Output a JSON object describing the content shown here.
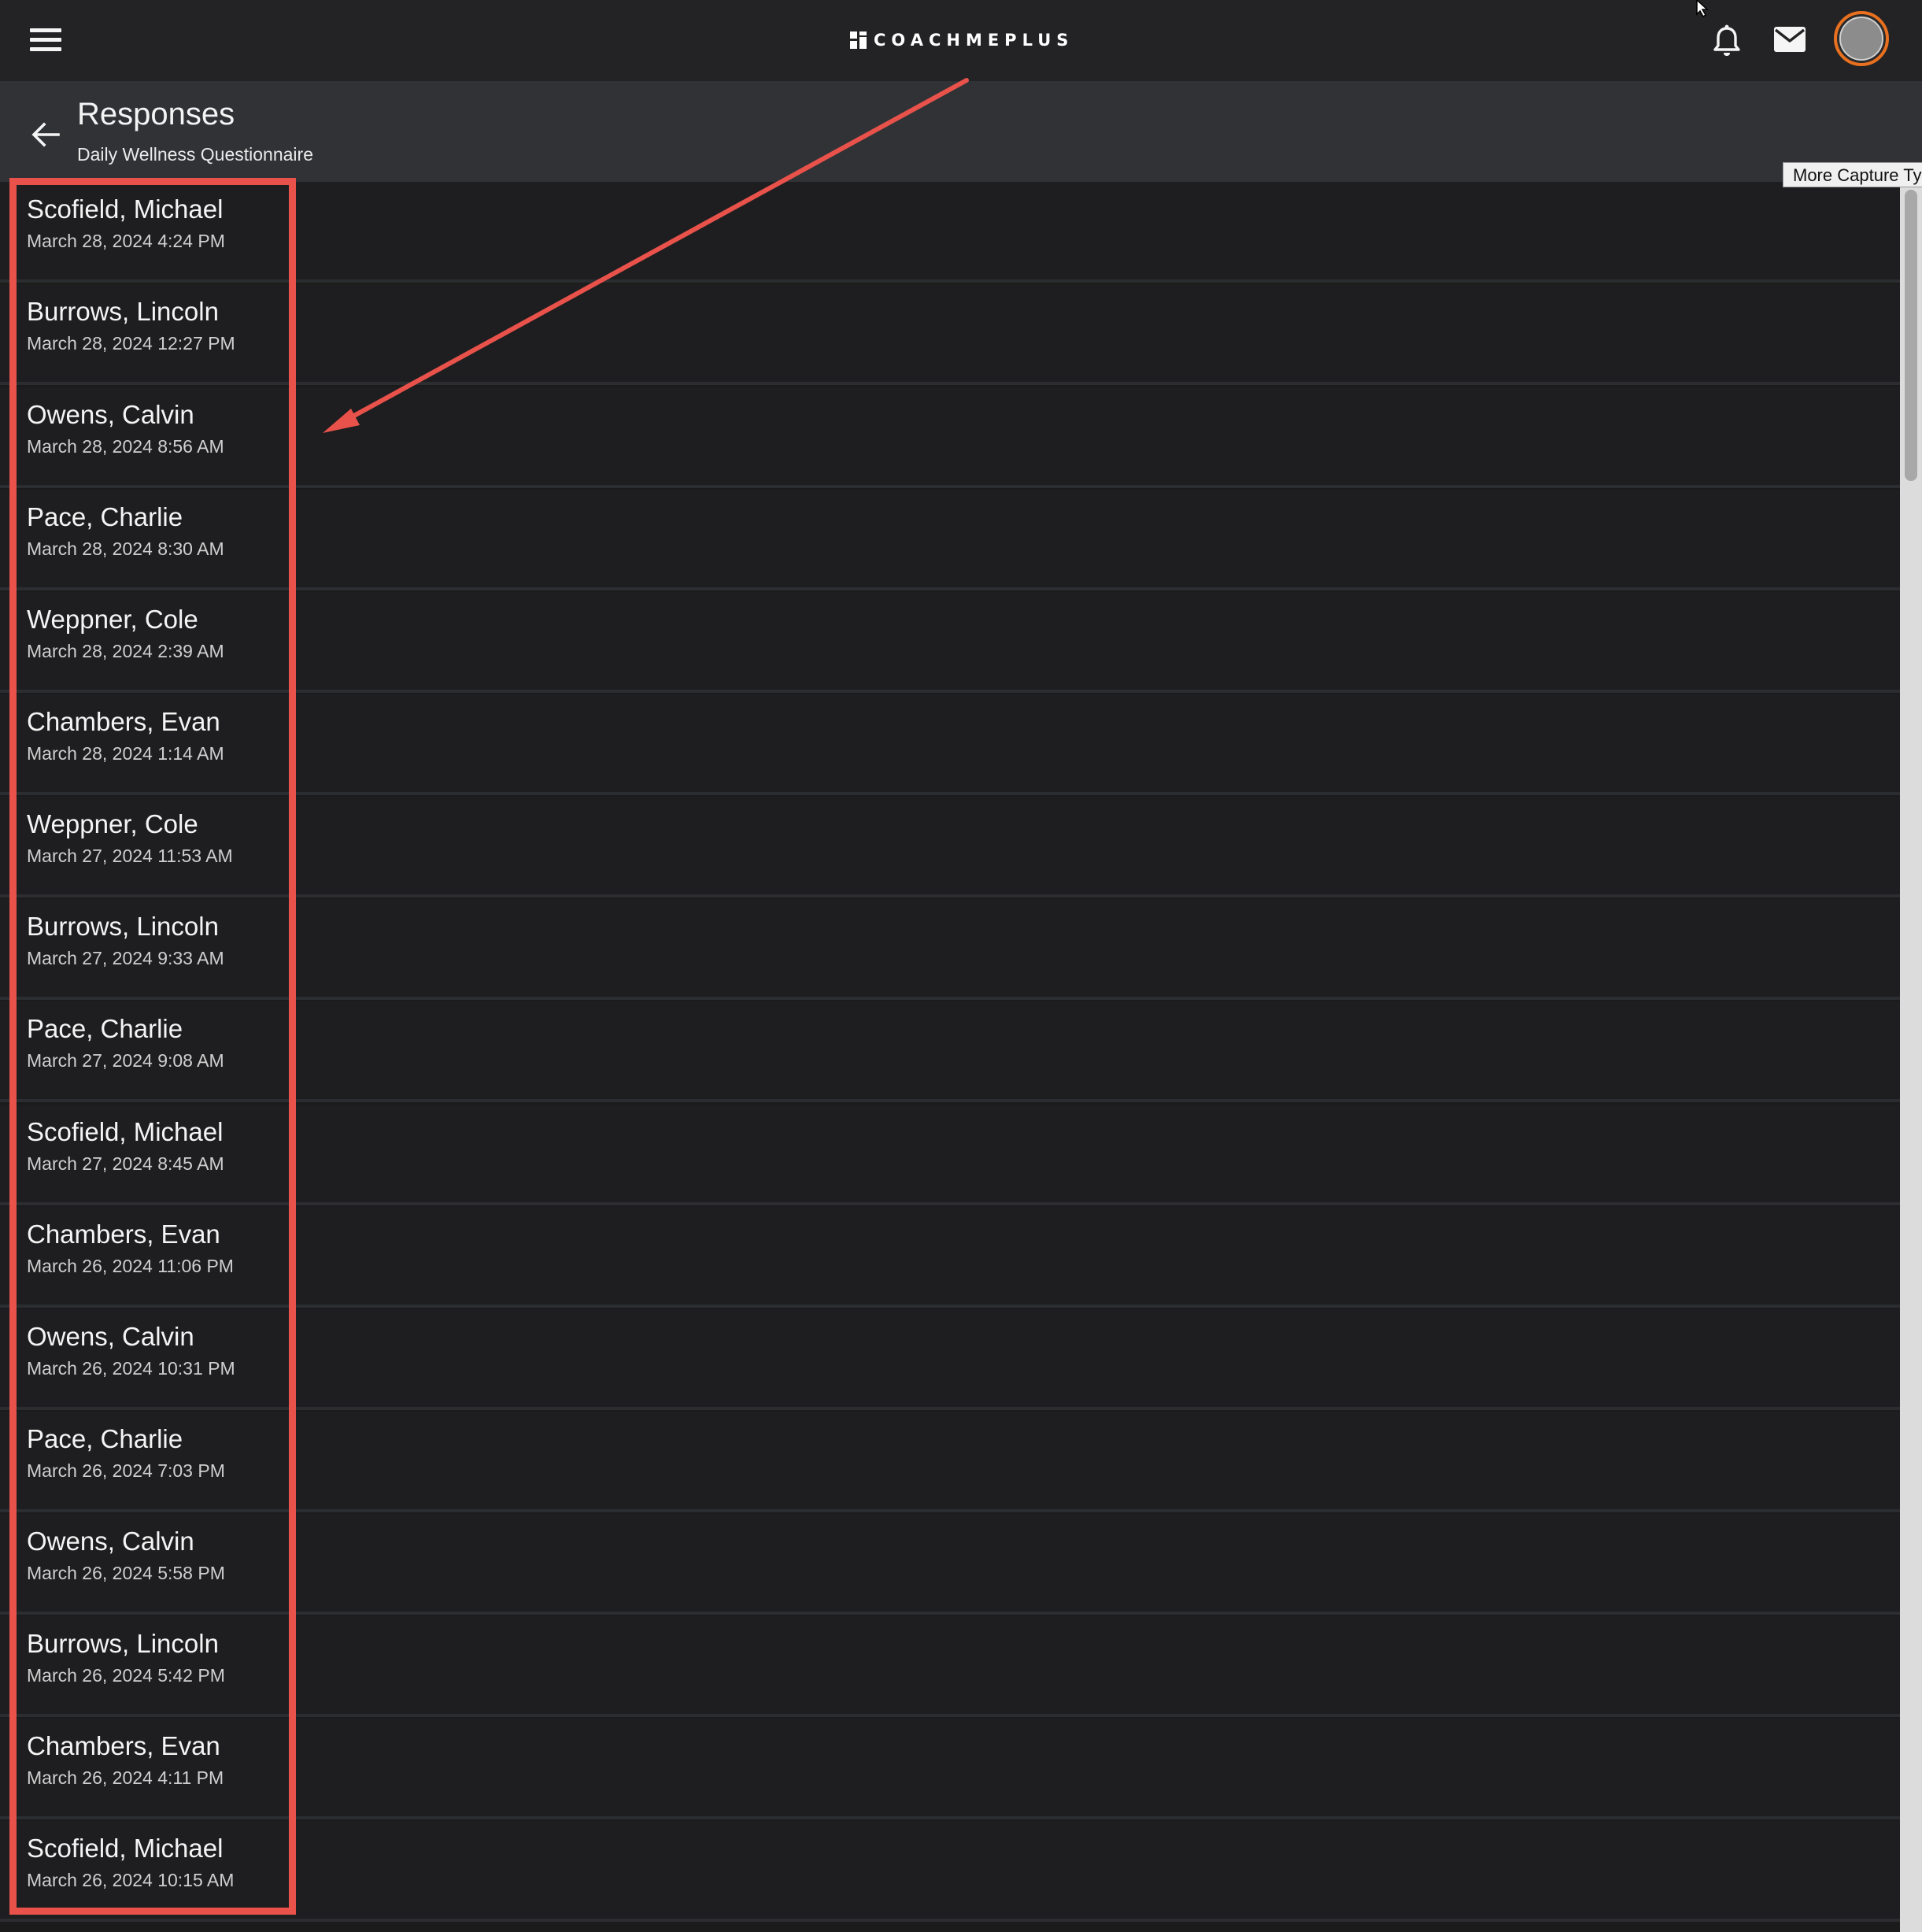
{
  "app": {
    "brand": "COACHMEPLUS"
  },
  "header": {
    "title": "Responses",
    "subtitle": "Daily Wellness Questionnaire"
  },
  "tooltip": {
    "text": "More Capture Ty"
  },
  "icons": {
    "menu": "hamburger-menu-icon",
    "back": "arrow-left-icon",
    "notifications": "bell-icon",
    "messages": "envelope-icon",
    "avatar": "user-avatar",
    "cursor": "mouse-pointer-icon"
  },
  "colors": {
    "topbar": "#232325",
    "subheader": "#303236",
    "list_background": "#1e1e20",
    "annotation": "#e8524a",
    "avatar_ring": "#e8701f"
  },
  "responses": [
    {
      "name": "Scofield, Michael",
      "date": "March 28, 2024 4:24 PM"
    },
    {
      "name": "Burrows, Lincoln",
      "date": "March 28, 2024 12:27 PM"
    },
    {
      "name": "Owens, Calvin",
      "date": "March 28, 2024 8:56 AM"
    },
    {
      "name": "Pace, Charlie",
      "date": "March 28, 2024 8:30 AM"
    },
    {
      "name": "Weppner, Cole",
      "date": "March 28, 2024 2:39 AM"
    },
    {
      "name": "Chambers, Evan",
      "date": "March 28, 2024 1:14 AM"
    },
    {
      "name": "Weppner, Cole",
      "date": "March 27, 2024 11:53 AM"
    },
    {
      "name": "Burrows, Lincoln",
      "date": "March 27, 2024 9:33 AM"
    },
    {
      "name": "Pace, Charlie",
      "date": "March 27, 2024 9:08 AM"
    },
    {
      "name": "Scofield, Michael",
      "date": "March 27, 2024 8:45 AM"
    },
    {
      "name": "Chambers, Evan",
      "date": "March 26, 2024 11:06 PM"
    },
    {
      "name": "Owens, Calvin",
      "date": "March 26, 2024 10:31 PM"
    },
    {
      "name": "Pace, Charlie",
      "date": "March 26, 2024 7:03 PM"
    },
    {
      "name": "Owens, Calvin",
      "date": "March 26, 2024 5:58 PM"
    },
    {
      "name": "Burrows, Lincoln",
      "date": "March 26, 2024 5:42 PM"
    },
    {
      "name": "Chambers, Evan",
      "date": "March 26, 2024 4:11 PM"
    },
    {
      "name": "Scofield, Michael",
      "date": "March 26, 2024 10:15 AM"
    }
  ]
}
